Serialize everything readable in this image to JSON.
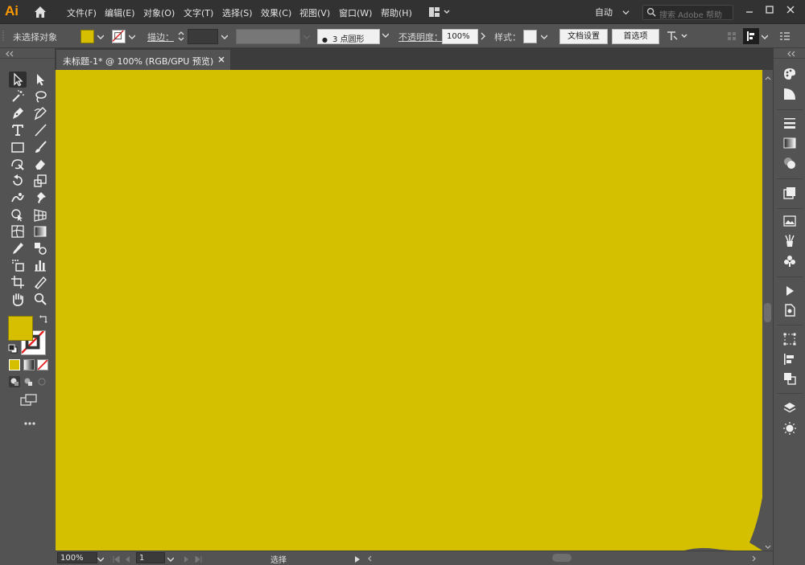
{
  "app": {
    "logo": "Ai"
  },
  "menu": [
    "文件(F)",
    "编辑(E)",
    "对象(O)",
    "文字(T)",
    "选择(S)",
    "效果(C)",
    "视图(V)",
    "窗口(W)",
    "帮助(H)"
  ],
  "workspace": {
    "label": "自动"
  },
  "search": {
    "placeholder": "搜索 Adobe 帮助"
  },
  "control": {
    "selection": "未选择对象",
    "stroke_label": "描边：",
    "brush": "3 点圆形",
    "opacity_label": "不透明度：",
    "opacity_value": "100%",
    "style_label": "样式：",
    "doc_setup": "文档设置",
    "prefs": "首选项"
  },
  "document": {
    "tab_title": "未标题-1* @ 100% (RGB/GPU 预览)"
  },
  "status": {
    "zoom": "100%",
    "artboard": "1",
    "tool": "选择"
  },
  "colors": {
    "fill": "#d5bf00",
    "canvas": "#d5c000",
    "ui_bg": "#535353",
    "menubar_bg": "#323232"
  },
  "icons": {
    "tools": [
      "selection-tool-icon",
      "direct-selection-tool-icon",
      "magic-wand-tool-icon",
      "lasso-tool-icon",
      "pen-tool-icon",
      "curvature-tool-icon",
      "type-tool-icon",
      "line-segment-tool-icon",
      "rectangle-tool-icon",
      "paintbrush-tool-icon",
      "shaper-tool-icon",
      "eraser-tool-icon",
      "rotate-tool-icon",
      "scale-tool-icon",
      "warp-tool-icon",
      "puppet-warp-tool-icon",
      "shape-builder-tool-icon",
      "perspective-grid-tool-icon",
      "mesh-tool-icon",
      "gradient-tool-icon",
      "eyedropper-tool-icon",
      "blend-tool-icon",
      "symbol-sprayer-tool-icon",
      "column-graph-tool-icon",
      "artboard-tool-icon",
      "slice-tool-icon",
      "hand-tool-icon",
      "zoom-tool-icon"
    ],
    "panels": [
      "color-panel-icon",
      "color-guide-panel-icon",
      "stroke-panel-icon",
      "gradient-panel-icon",
      "transparency-panel-icon",
      "appearance-panel-icon",
      "image-trace-panel-icon",
      "brushes-panel-icon",
      "symbols-panel-icon",
      "actions-panel-icon",
      "links-panel-icon",
      "transform-panel-icon",
      "align-panel-icon",
      "pathfinder-panel-icon",
      "layers-panel-icon",
      "asset-export-panel-icon"
    ]
  }
}
